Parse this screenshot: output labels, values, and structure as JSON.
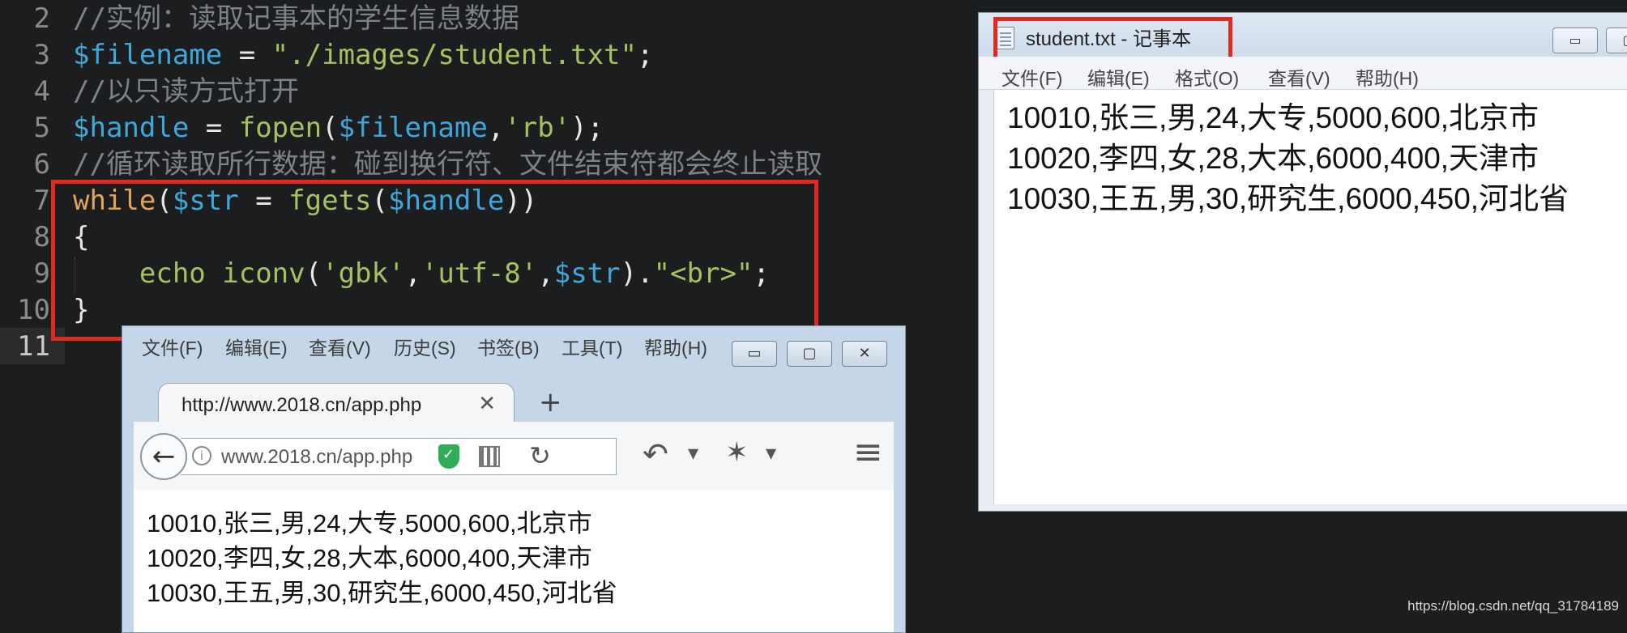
{
  "editor": {
    "lines": [
      {
        "num": "2",
        "tokens": [
          {
            "t": "//实例：读取记事本的学生信息数据",
            "c": "cmt"
          }
        ]
      },
      {
        "num": "3",
        "tokens": [
          {
            "t": "$filename",
            "c": "var"
          },
          {
            "t": " = ",
            "c": "pun"
          },
          {
            "t": "\"./images/student.txt\"",
            "c": "str"
          },
          {
            "t": ";",
            "c": "pun"
          }
        ]
      },
      {
        "num": "4",
        "tokens": [
          {
            "t": "//以只读方式打开",
            "c": "cmt"
          }
        ]
      },
      {
        "num": "5",
        "tokens": [
          {
            "t": "$handle",
            "c": "var"
          },
          {
            "t": " = ",
            "c": "pun"
          },
          {
            "t": "fopen",
            "c": "fn"
          },
          {
            "t": "(",
            "c": "pun"
          },
          {
            "t": "$filename",
            "c": "var"
          },
          {
            "t": ",",
            "c": "pun"
          },
          {
            "t": "'rb'",
            "c": "str"
          },
          {
            "t": ");",
            "c": "pun"
          }
        ]
      },
      {
        "num": "6",
        "tokens": [
          {
            "t": "//循环读取所行数据：碰到换行符、文件结束符都会终止读取",
            "c": "cmt"
          }
        ]
      },
      {
        "num": "7",
        "tokens": [
          {
            "t": "while",
            "c": "kw"
          },
          {
            "t": "(",
            "c": "pun"
          },
          {
            "t": "$str",
            "c": "var"
          },
          {
            "t": " = ",
            "c": "pun"
          },
          {
            "t": "fgets",
            "c": "fn"
          },
          {
            "t": "(",
            "c": "pun"
          },
          {
            "t": "$handle",
            "c": "var"
          },
          {
            "t": "))",
            "c": "pun"
          }
        ]
      },
      {
        "num": "8",
        "tokens": [
          {
            "t": "{",
            "c": "pun"
          }
        ]
      },
      {
        "num": "9",
        "tokens": [
          {
            "t": "    ",
            "c": "pun"
          },
          {
            "t": "echo",
            "c": "echo"
          },
          {
            "t": " ",
            "c": "pun"
          },
          {
            "t": "iconv",
            "c": "fn"
          },
          {
            "t": "(",
            "c": "pun"
          },
          {
            "t": "'gbk'",
            "c": "str"
          },
          {
            "t": ",",
            "c": "pun"
          },
          {
            "t": "'utf-8'",
            "c": "str"
          },
          {
            "t": ",",
            "c": "pun"
          },
          {
            "t": "$str",
            "c": "var"
          },
          {
            "t": ").",
            "c": "pun"
          },
          {
            "t": "\"<br>\"",
            "c": "str"
          },
          {
            "t": ";",
            "c": "pun"
          }
        ]
      },
      {
        "num": "10",
        "tokens": [
          {
            "t": "}",
            "c": "pun"
          }
        ]
      },
      {
        "num": "11",
        "tokens": []
      }
    ]
  },
  "notepad": {
    "title": "student.txt - 记事本",
    "minimize": "▭",
    "maximize": "▢",
    "menu": [
      "文件(F)",
      "编辑(E)",
      "格式(O)",
      "查看(V)",
      "帮助(H)"
    ],
    "content": "10010,张三,男,24,大专,5000,600,北京市\n10020,李四,女,28,大本,6000,400,天津市\n10030,王五,男,30,研究生,6000,450,河北省"
  },
  "browser": {
    "menu": [
      "文件(F)",
      "编辑(E)",
      "查看(V)",
      "历史(S)",
      "书签(B)",
      "工具(T)",
      "帮助(H)"
    ],
    "minimize": "▭",
    "maximize": "▢",
    "close": "✕",
    "tab_title": "http://www.2018.cn/app.php",
    "tab_close": "✕",
    "new_tab": "+",
    "back": "←",
    "info": "i",
    "url": "www.2018.cn/app.php",
    "reload": "↻",
    "undo": "↶",
    "dropdown": "▾",
    "addon": "✶",
    "menu_button": "≡",
    "content": "10010,张三,男,24,大专,5000,600,北京市\n10020,李四,女,28,大本,6000,400,天津市\n10030,王五,男,30,研究生,6000,450,河北省"
  },
  "watermark": "https://blog.csdn.net/qq_31784189",
  "colors": {
    "highlight_box": "#e02a20",
    "editor_bg": "#1c1d1e"
  }
}
